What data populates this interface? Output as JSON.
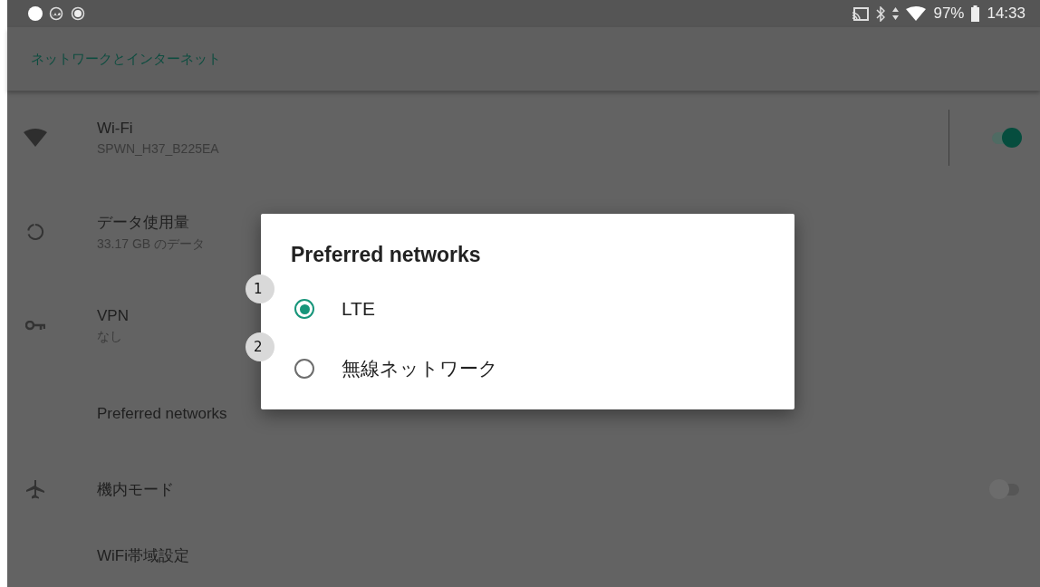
{
  "status_bar": {
    "battery": "97%",
    "time": "14:33"
  },
  "app_bar": {
    "title": "ネットワークとインターネット"
  },
  "settings": [
    {
      "kind": "wifi",
      "title": "Wi-Fi",
      "subtitle": "SPWN_H37_B225EA",
      "on": true
    },
    {
      "kind": "data",
      "title": "データ使用量",
      "subtitle": "33.17 GB のデータ"
    },
    {
      "kind": "vpn",
      "title": "VPN",
      "subtitle": "なし"
    },
    {
      "kind": "plain",
      "title": "Preferred networks"
    },
    {
      "kind": "airplane",
      "title": "機内モード",
      "on": false
    },
    {
      "kind": "plain",
      "title": "WiFi帯域設定"
    }
  ],
  "dialog": {
    "title": "Preferred networks",
    "options": [
      {
        "label": "LTE",
        "selected": true,
        "badge": "1"
      },
      {
        "label": "無線ネットワーク",
        "selected": false,
        "badge": "2"
      }
    ]
  }
}
